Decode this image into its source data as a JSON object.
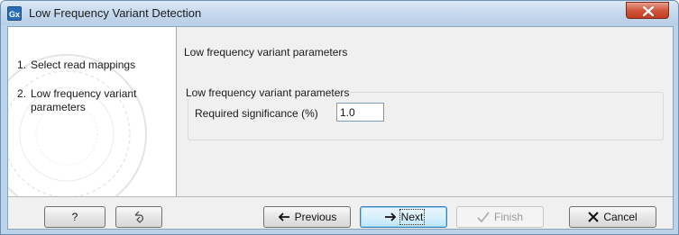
{
  "window": {
    "app_icon_text": "Gx",
    "title": "Low Frequency Variant Detection"
  },
  "steps": [
    {
      "number": "1.",
      "label": "Select read mappings"
    },
    {
      "number": "2.",
      "label": "Low frequency variant parameters"
    }
  ],
  "panel": {
    "heading": "Low frequency variant parameters",
    "group_title": "Low frequency variant parameters",
    "field_label": "Required significance (%)",
    "field_value": "1.0"
  },
  "buttons": {
    "help": "?",
    "previous": "Previous",
    "next": "Next",
    "finish": "Finish",
    "cancel": "Cancel"
  },
  "colors": {
    "titlebar": "#c2d6ec",
    "close": "#c03c22",
    "accent_arrow": "#111111",
    "disabled": "#9a9a9a"
  }
}
